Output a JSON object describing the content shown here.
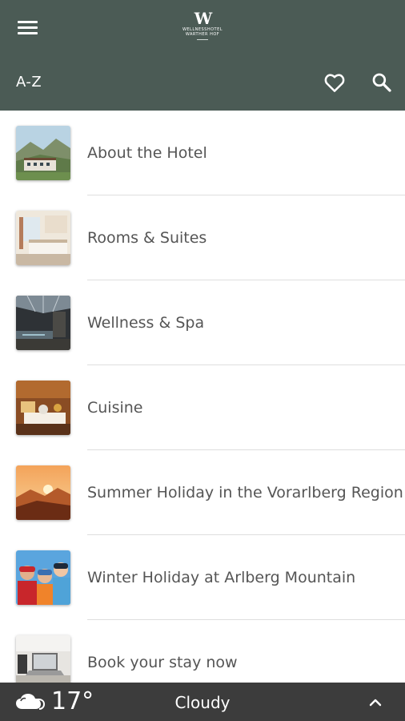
{
  "header": {
    "logo": {
      "mark": "W",
      "line1": "WELLNESSHOTEL",
      "line2": "WARTHER HOF"
    },
    "sort_label": "A-Z",
    "icons": {
      "menu": "hamburger-menu-icon",
      "favorites": "heart-icon",
      "search": "search-icon"
    }
  },
  "list": {
    "items": [
      {
        "label": "About the Hotel",
        "thumb": "hotel-mountain-photo"
      },
      {
        "label": "Rooms & Suites",
        "thumb": "hotel-room-photo"
      },
      {
        "label": "Wellness & Spa",
        "thumb": "spa-pool-photo"
      },
      {
        "label": "Cuisine",
        "thumb": "dining-table-photo"
      },
      {
        "label": "Summer Holiday in the Vorarlberg Region",
        "thumb": "sunset-mountains-photo"
      },
      {
        "label": "Winter Holiday at Arlberg Mountain",
        "thumb": "skiers-photo"
      },
      {
        "label": "Book your stay now",
        "thumb": "laptop-desk-photo"
      }
    ]
  },
  "weather": {
    "temperature": "17°",
    "condition": "Cloudy",
    "icon": "cloud-icon",
    "expand_icon": "chevron-up-icon"
  },
  "colors": {
    "header": "#4b5b55",
    "weather_bar": "#3c3c3c",
    "text": "#555555",
    "separator": "#dedede"
  }
}
